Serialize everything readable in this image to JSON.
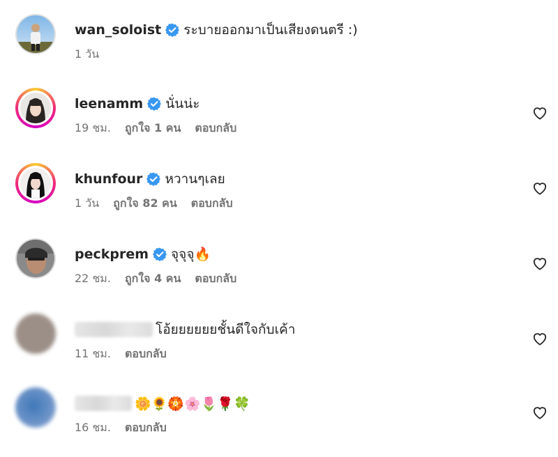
{
  "comments": [
    {
      "username": "wan_soloist",
      "verified": true,
      "text": "ระบายออกมาเป็นเสียงดนตรี :)",
      "time": "1 วัน",
      "likes": "",
      "reply": "",
      "has_heart": false
    },
    {
      "username": "leenamm",
      "verified": true,
      "text": "นั่นน่ะ",
      "time": "19 ชม.",
      "likes": "ถูกใจ 1 คน",
      "reply": "ตอบกลับ",
      "has_heart": true
    },
    {
      "username": "khunfour",
      "verified": true,
      "text": "หวานๆเลย",
      "time": "1 วัน",
      "likes": "ถูกใจ 82 คน",
      "reply": "ตอบกลับ",
      "has_heart": true
    },
    {
      "username": "peckprem",
      "verified": true,
      "text": "จุจุจุ🔥",
      "time": "22 ชม.",
      "likes": "ถูกใจ 4 คน",
      "reply": "ตอบกลับ",
      "has_heart": true
    },
    {
      "username": "",
      "verified": false,
      "text": "โอ้ยยยยยยชั้นดีใจกับเค้า",
      "time": "11 ชม.",
      "likes": "",
      "reply": "ตอบกลับ",
      "has_heart": true
    },
    {
      "username": "",
      "verified": false,
      "text": "🌼🌻🏵️🌸🌷🌹🍀",
      "time": "16 ชม.",
      "likes": "",
      "reply": "ตอบกลับ",
      "has_heart": true
    }
  ],
  "colors": {
    "verified": "#3897f0",
    "text": "#262626",
    "meta": "#737373"
  }
}
